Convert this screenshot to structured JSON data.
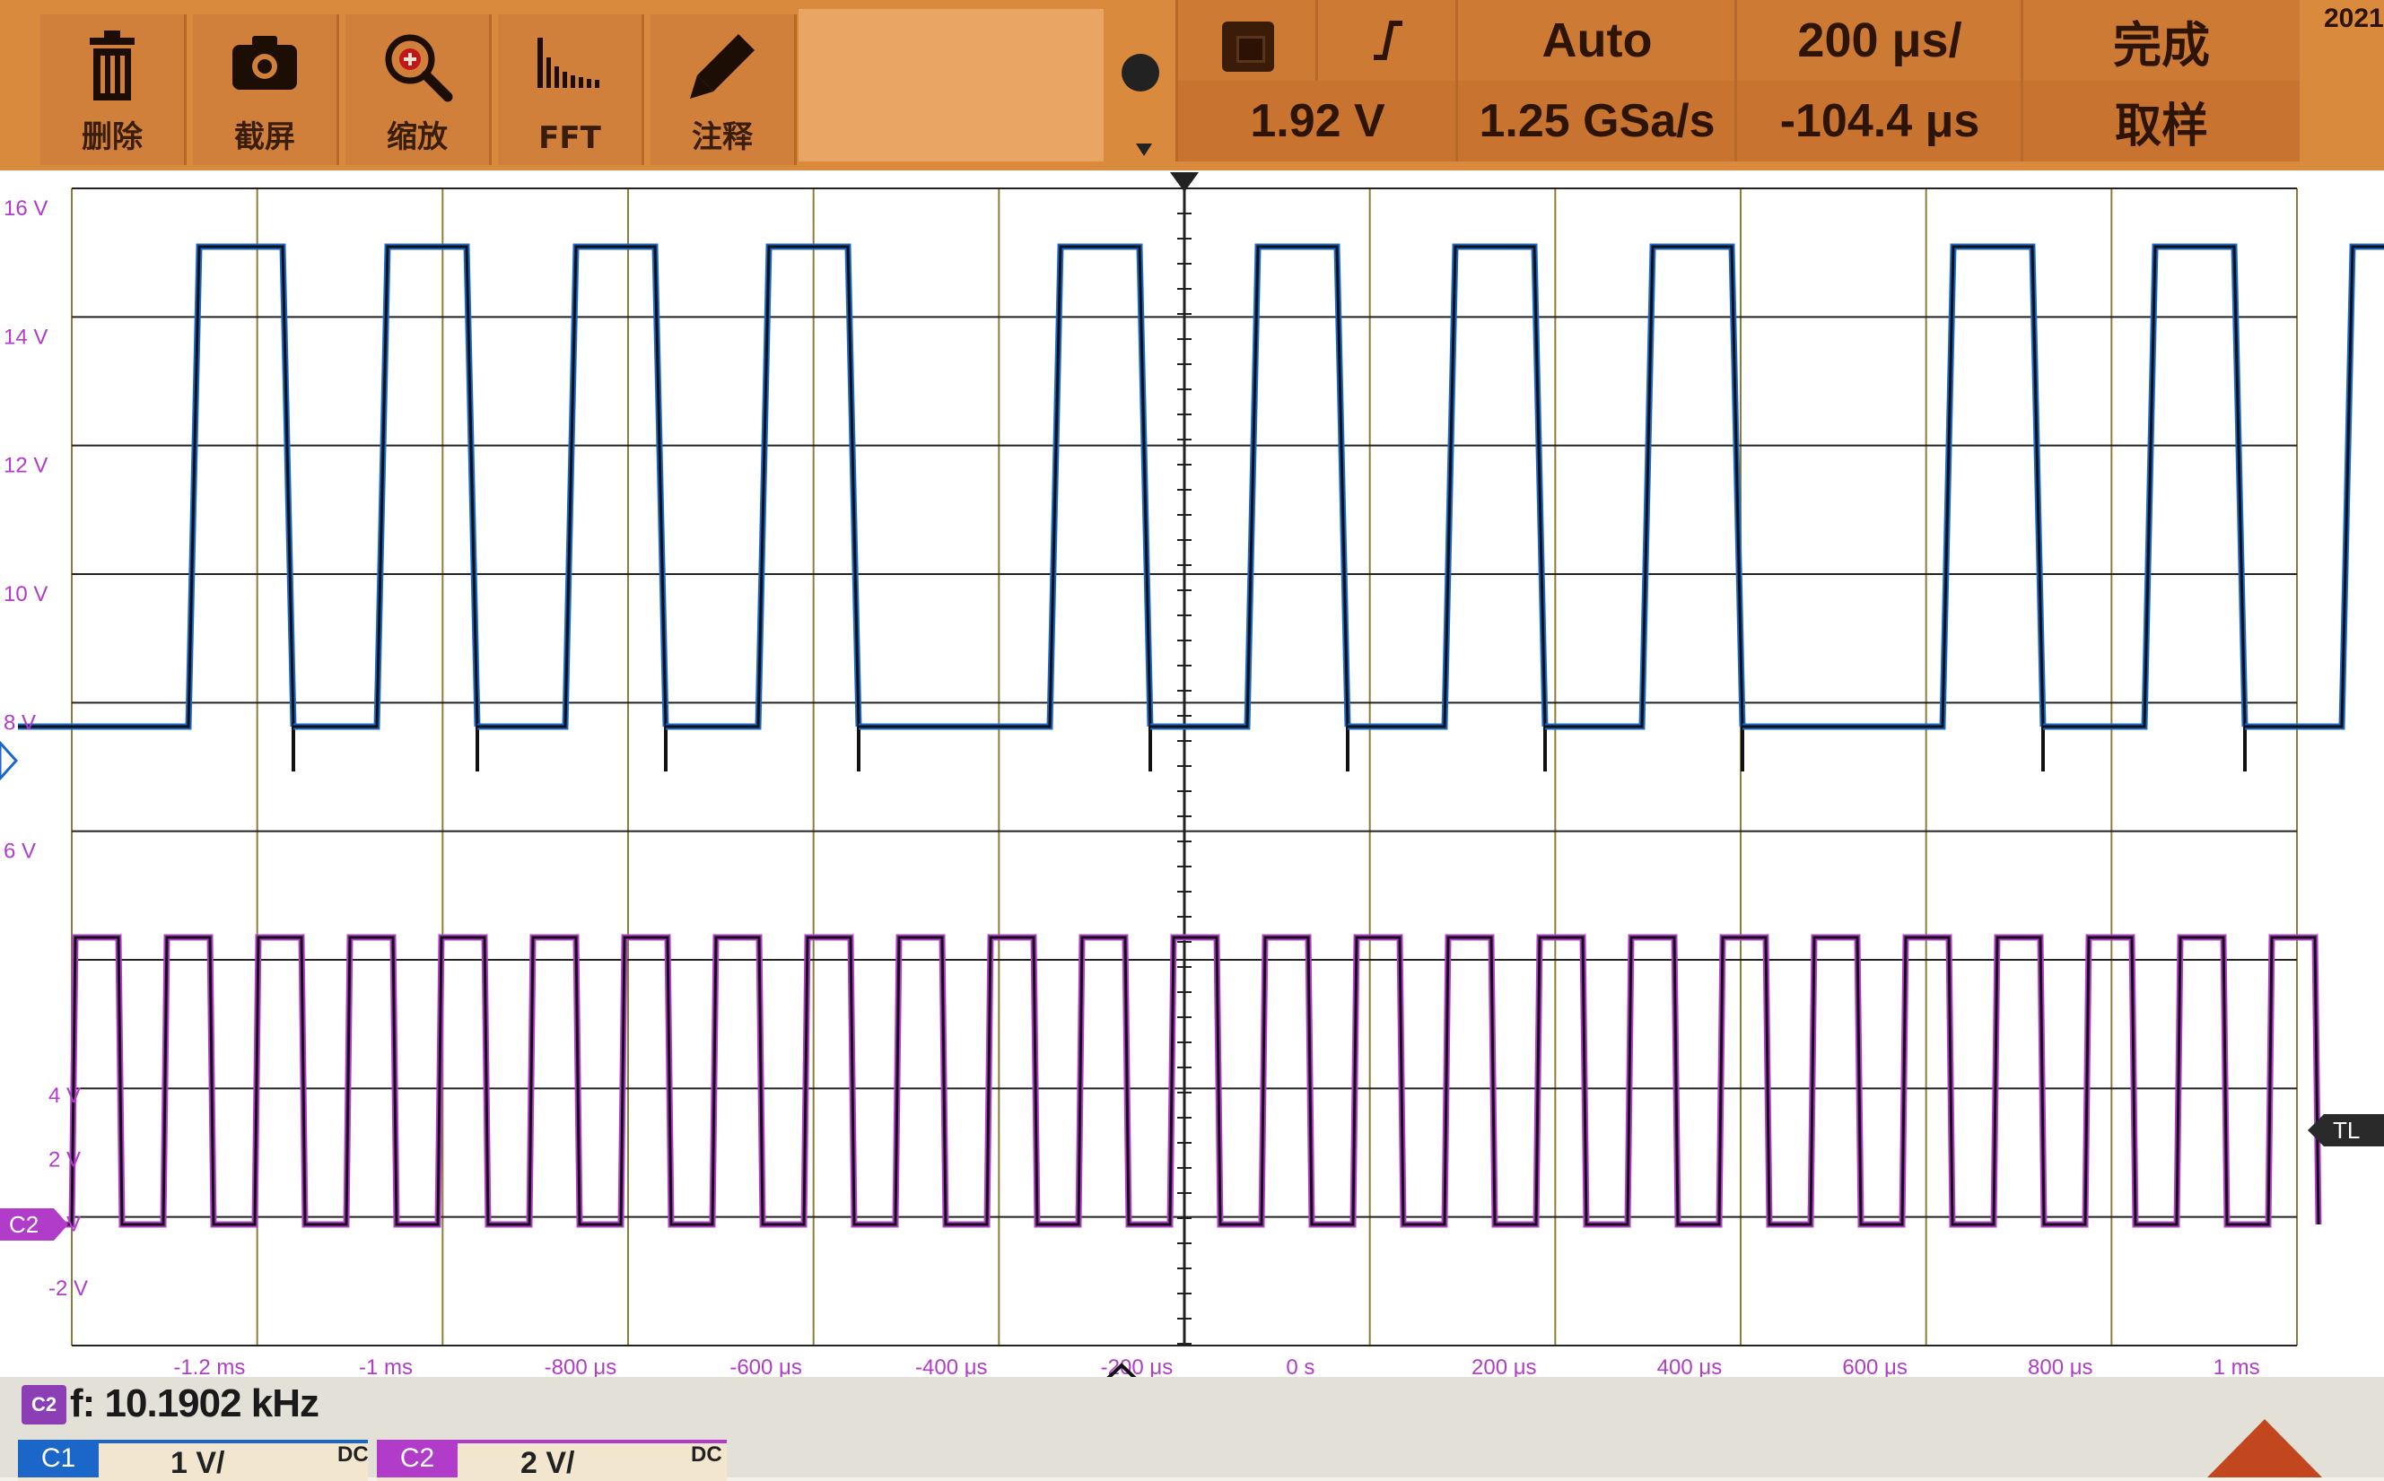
{
  "toolbar": {
    "tools": [
      {
        "label": "删除",
        "icon": "trash-icon"
      },
      {
        "label": "截屏",
        "icon": "camera-icon"
      },
      {
        "label": "缩放",
        "icon": "zoom-in-icon"
      },
      {
        "label": "FFT",
        "icon": "fft-icon"
      },
      {
        "label": "注释",
        "icon": "pencil-icon"
      }
    ]
  },
  "trigger": {
    "edge_icon": "rising-edge-icon",
    "mode": "Auto",
    "level": "1.92 V"
  },
  "timebase": {
    "scale": "200 μs/",
    "sample_rate": "1.25 GSa/s",
    "delay": "-104.4 μs"
  },
  "acquisition": {
    "status": "完成",
    "mode": "取样"
  },
  "date_fragment": "2021",
  "y_axis_ch1": [
    "16 V",
    "14 V",
    "12 V",
    "10 V",
    "8 V",
    "6 V"
  ],
  "y_axis_ch2": [
    "4 V",
    "2 V",
    "0 V",
    "-2 V"
  ],
  "x_axis": [
    "-1.2 ms",
    "-1 ms",
    "-800 μs",
    "-600 μs",
    "-400 μs",
    "-200 μs",
    "0 s",
    "200 μs",
    "400 μs",
    "600 μs",
    "800 μs",
    "1 ms"
  ],
  "markers": {
    "ch2": "C2",
    "trigger_level": "TL"
  },
  "measurement": {
    "badge": "C2",
    "text": "f: 10.1902 kHz"
  },
  "channels": [
    {
      "tag": "C1",
      "scale": "1 V/",
      "coupling": "DC",
      "color": "#1b67c9"
    },
    {
      "tag": "C2",
      "scale": "2 V/",
      "coupling": "DC",
      "color": "#b13cc9"
    }
  ],
  "colors": {
    "toolbar": "#d98a3c",
    "ch1": "#1b67c9",
    "ch2": "#b13cc9",
    "grid": "#8a7f3a"
  }
}
